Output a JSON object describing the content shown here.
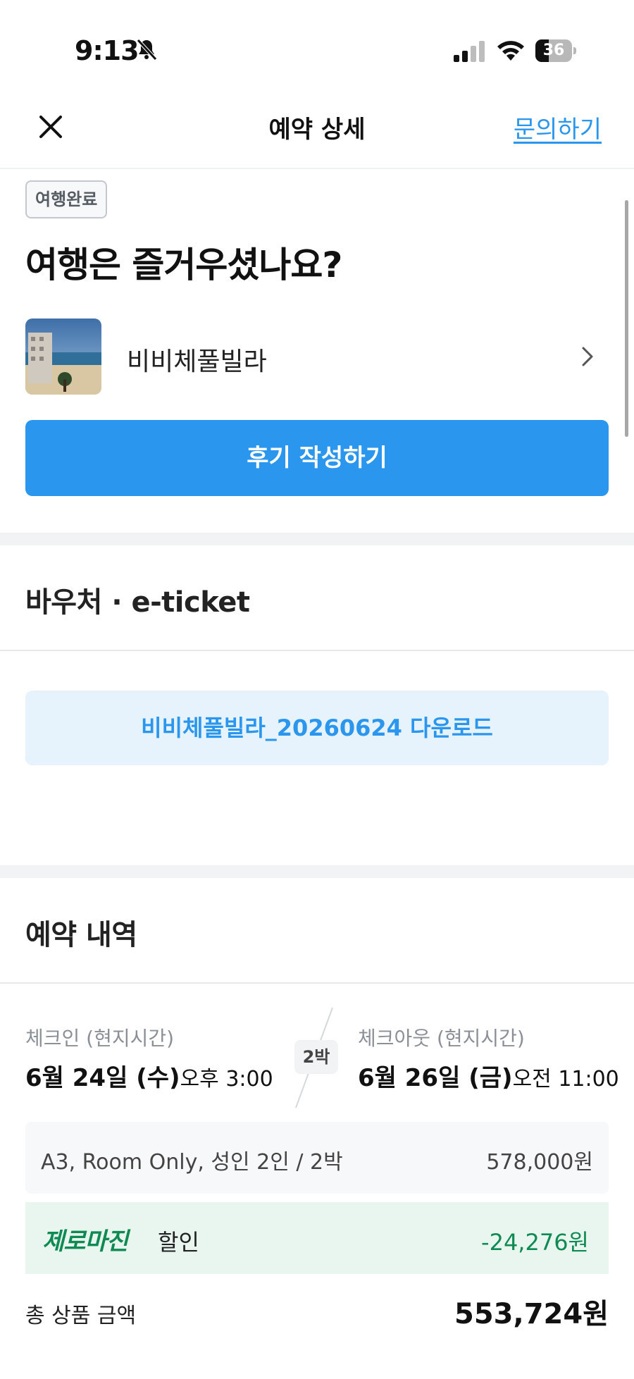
{
  "status_bar": {
    "time": "9:13",
    "battery": "36",
    "battery_level_percent": 36
  },
  "nav": {
    "title": "예약 상세",
    "inquiry_label": "문의하기"
  },
  "trip": {
    "badge": "여행완료",
    "heading": "여행은 즐거우셨나요?",
    "property_name": "비비체풀빌라",
    "review_button": "후기 작성하기"
  },
  "voucher": {
    "title": "바우처 · e-ticket",
    "download_label": "비비체풀빌라_20260624 다운로드"
  },
  "reservation": {
    "title": "예약 내역",
    "check_in": {
      "label": "체크인 (현지시간)",
      "date": "6월 24일 (수)",
      "time": "오후 3:00"
    },
    "nights": "2박",
    "check_out": {
      "label": "체크아웃 (현지시간)",
      "date": "6월 26일 (금)",
      "time": "오전 11:00"
    },
    "room_description": "A3, Room Only, 성인 2인 / 2박",
    "room_price": "578,000원",
    "discount_brand": "제로마진",
    "discount_label": "할인",
    "discount_amount": "-24,276원",
    "total_label": "총 상품 금액",
    "total_amount": "553,724원"
  },
  "colors": {
    "accent_blue": "#2b96ed",
    "discount_green": "#0f8a52"
  }
}
